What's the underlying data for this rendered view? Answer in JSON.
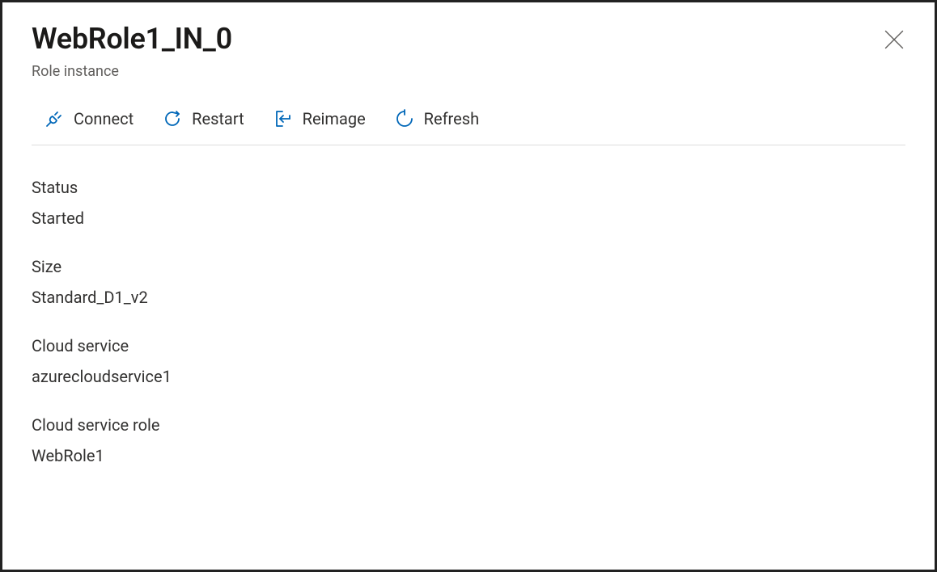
{
  "header": {
    "title": "WebRole1_IN_0",
    "subtitle": "Role instance"
  },
  "toolbar": {
    "connect_label": "Connect",
    "restart_label": "Restart",
    "reimage_label": "Reimage",
    "refresh_label": "Refresh"
  },
  "fields": {
    "status": {
      "label": "Status",
      "value": "Started"
    },
    "size": {
      "label": "Size",
      "value": "Standard_D1_v2"
    },
    "cloud_service": {
      "label": "Cloud service",
      "value": "azurecloudservice1"
    },
    "cloud_service_role": {
      "label": "Cloud service role",
      "value": "WebRole1"
    }
  }
}
